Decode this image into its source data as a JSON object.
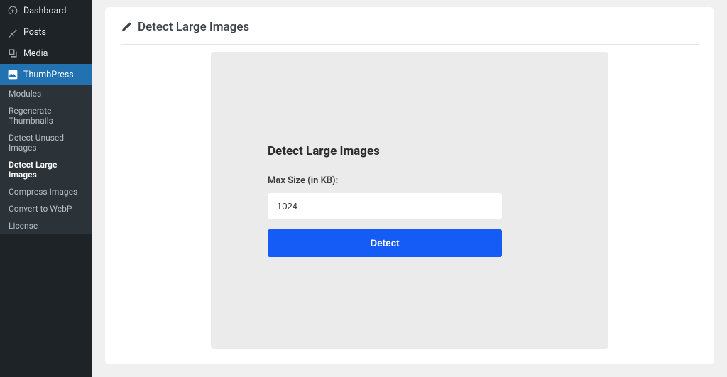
{
  "sidebar": {
    "items": [
      {
        "label": "Dashboard"
      },
      {
        "label": "Posts"
      },
      {
        "label": "Media"
      },
      {
        "label": "ThumbPress"
      }
    ],
    "submenu": [
      {
        "label": "Modules"
      },
      {
        "label": "Regenerate Thumbnails"
      },
      {
        "label": "Detect Unused Images"
      },
      {
        "label": "Detect Large Images"
      },
      {
        "label": "Compress Images"
      },
      {
        "label": "Convert to WebP"
      },
      {
        "label": "License"
      }
    ]
  },
  "page": {
    "title": "Detect Large Images"
  },
  "panel": {
    "heading": "Detect Large Images",
    "field_label": "Max Size (in KB):",
    "field_value": "1024",
    "button_label": "Detect"
  },
  "colors": {
    "primary_button": "#155bf5",
    "sidebar_bg": "#1d2327",
    "sidebar_active": "#2271b1",
    "panel_bg": "#ebebeb"
  }
}
